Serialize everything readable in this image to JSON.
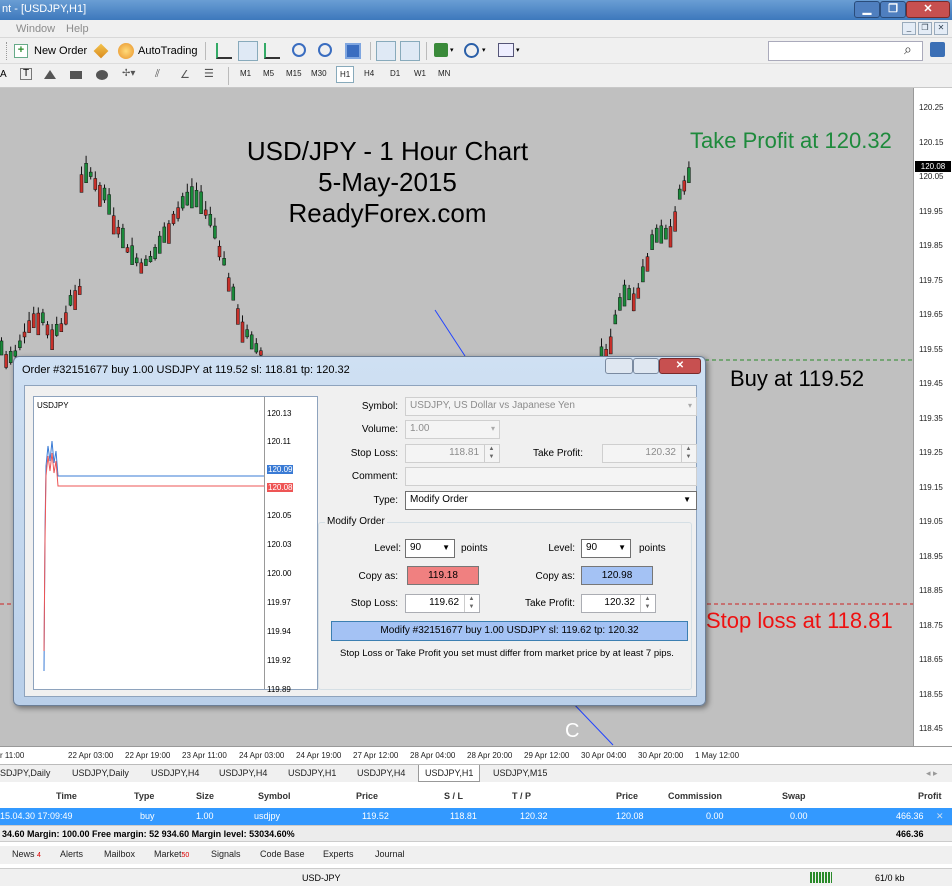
{
  "window": {
    "title": "nt - [USDJPY,H1]",
    "min": "▁",
    "max": "❐",
    "close": "✕"
  },
  "menu": {
    "items": [
      "Window",
      "Help"
    ],
    "mdi_min": "_",
    "mdi_restore": "❐",
    "mdi_close": "✕"
  },
  "toolbar": {
    "new_order": "New Order",
    "autotrading": "AutoTrading",
    "search_icon": "⌕",
    "timeframes": [
      "M1",
      "M5",
      "M15",
      "M30",
      "H1",
      "H4",
      "D1",
      "W1",
      "MN"
    ],
    "active_tf": "H1"
  },
  "chart": {
    "title_lines": [
      "USD/JPY - 1 Hour Chart",
      "5-May-2015",
      "ReadyForex.com"
    ],
    "annotation_tp": "Take Profit at 120.32",
    "annotation_buy": "Buy at 119.52",
    "annotation_sl": "Stop loss at 118.81",
    "label_c": "C",
    "price_ticks": [
      "120.25",
      "120.15",
      "120.05",
      "119.95",
      "119.85",
      "119.75",
      "119.65",
      "119.55",
      "119.45",
      "119.35",
      "119.25",
      "119.15",
      "119.05",
      "118.95",
      "118.85",
      "118.75",
      "118.65",
      "118.55",
      "118.45"
    ],
    "current_price": "120.08",
    "time_ticks": [
      "r 11:00",
      "22 Apr 03:00",
      "22 Apr 19:00",
      "23 Apr 11:00",
      "24 Apr 03:00",
      "24 Apr 19:00",
      "27 Apr 12:00",
      "28 Apr 04:00",
      "28 Apr 20:00",
      "29 Apr 12:00",
      "30 Apr 04:00",
      "30 Apr 20:00",
      "1 May 12:00"
    ]
  },
  "chart_tabs": [
    "SDJPY,Daily",
    "USDJPY,Daily",
    "USDJPY,H4",
    "USDJPY,H4",
    "USDJPY,H1",
    "USDJPY,H4",
    "USDJPY,H1",
    "USDJPY,M15"
  ],
  "active_chart_tab": "USDJPY,H1",
  "dialog": {
    "title": "Order #32151677 buy 1.00 USDJPY at 119.52 sl: 118.81 tp: 120.32",
    "mini_symbol": "USDJPY",
    "mini_ticks": [
      "120.13",
      "120.11",
      "120.09",
      "120.08",
      "120.05",
      "120.03",
      "120.00",
      "119.97",
      "119.94",
      "119.92",
      "119.89"
    ],
    "symbol_label": "Symbol:",
    "symbol_value": "USDJPY, US Dollar vs Japanese Yen",
    "volume_label": "Volume:",
    "volume_value": "1.00",
    "sl_label": "Stop Loss:",
    "sl_value": "118.81",
    "tp_label": "Take Profit:",
    "tp_value": "120.32",
    "comment_label": "Comment:",
    "comment_value": "",
    "type_label": "Type:",
    "type_value": "Modify Order",
    "group_label": "Modify Order",
    "level_label": "Level:",
    "level_value": "90",
    "points_label": "points",
    "level2_label": "Level:",
    "level2_value": "90",
    "points2_label": "points",
    "copy_as_label": "Copy as:",
    "copy_sl_value": "119.18",
    "copy_as2_label": "Copy as:",
    "copy_tp_value": "120.98",
    "new_sl_label": "Stop Loss:",
    "new_sl_value": "119.62",
    "new_tp_label": "Take Profit:",
    "new_tp_value": "120.32",
    "modify_button": "Modify #32151677 buy 1.00 USDJPY sl: 119.62 tp: 120.32",
    "hint": "Stop Loss or Take Profit you set must differ from market price by at least 7 pips."
  },
  "terminal": {
    "headers": [
      "Time",
      "Type",
      "Size",
      "Symbol",
      "Price",
      "S / L",
      "T / P",
      "Price",
      "Commission",
      "Swap",
      "Profit"
    ],
    "row": [
      "15.04.30 17:09:49",
      "buy",
      "1.00",
      "usdjpy",
      "119.52",
      "118.81",
      "120.32",
      "120.08",
      "0.00",
      "0.00",
      "466.36"
    ],
    "balance_line": "34.60  Margin: 100.00  Free margin: 52 934.60  Margin level: 53034.60%",
    "balance_profit": "466.36",
    "tabs": [
      "News",
      "Alerts",
      "Mailbox",
      "Market",
      "Signals",
      "Code Base",
      "Experts",
      "Journal"
    ],
    "news_count": "4",
    "market_count": "50"
  },
  "status": {
    "symbol": "USD-JPY",
    "traffic": "61/0 kb"
  },
  "colors": {
    "chart_bg": "#c0c0c0",
    "bull": "#1a8a3a",
    "bear": "#c8302a",
    "tp_text": "#1e8a3c",
    "sl_text": "#ee1111",
    "copy_sl": "#f08080",
    "copy_tp": "#a4c2f4",
    "selected_row": "#3399ff"
  }
}
